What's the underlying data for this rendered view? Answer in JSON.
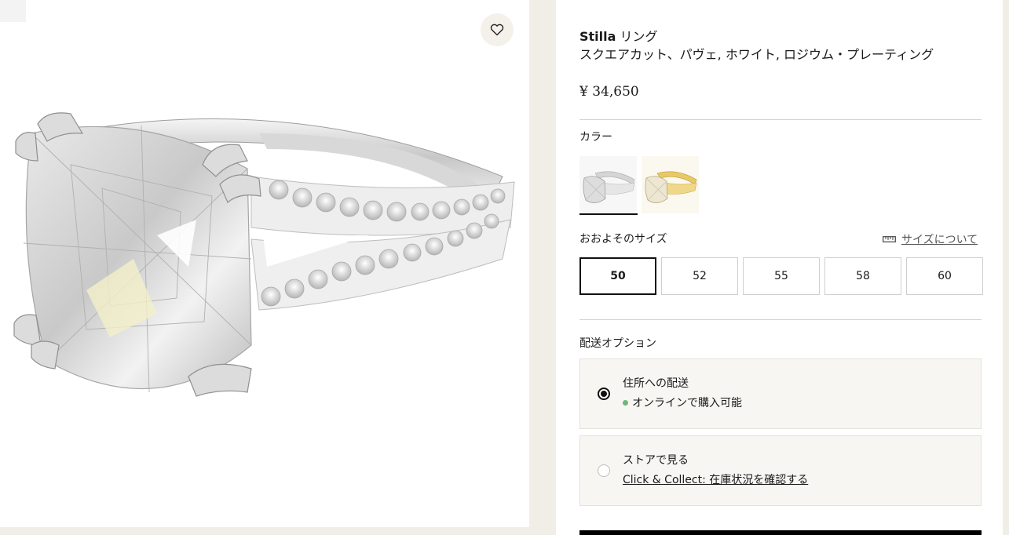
{
  "wishlist": {
    "icon": "heart-icon"
  },
  "product": {
    "brand": "Stilla",
    "type": "リング",
    "description": "スクエアカット、パヴェ, ホワイト, ロジウム・プレーティング",
    "price": "¥ 34,650"
  },
  "color": {
    "label": "カラー",
    "swatches": [
      {
        "name": "ホワイト / ロジウム",
        "selected": true
      },
      {
        "name": "ゴールドトーン",
        "selected": false
      }
    ]
  },
  "size": {
    "label": "おおよそのサイズ",
    "guide_icon": "ruler-icon",
    "guide_link": "サイズについて",
    "options": [
      "50",
      "52",
      "55",
      "58",
      "60"
    ],
    "selected": "50"
  },
  "delivery": {
    "label": "配送オプション",
    "options": [
      {
        "title": "住所への配送",
        "subtitle": "オンラインで購入可能",
        "selected": true
      },
      {
        "title": "ストアで見る",
        "subtitle": "Click & Collect: 在庫状況を確認する",
        "selected": false
      }
    ]
  },
  "colors": {
    "available": "#6db77a",
    "accent": "#111111",
    "background": "#f0eee6"
  }
}
